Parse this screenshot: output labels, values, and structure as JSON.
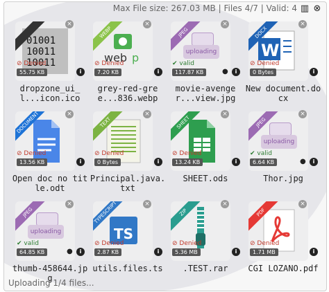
{
  "header": {
    "text": "Max File size: 267.03 MB | Files 4/7 | Valid: 4"
  },
  "footer": {
    "text": "Uploading 1/4 files..."
  },
  "labels": {
    "denied": "Denied",
    "valid": "valid",
    "uploading": "uploading",
    "remove_glyph": "×",
    "info_glyph": "i",
    "eye_glyph": "●"
  },
  "files": [
    {
      "name": "dropzone_ui_l...icon.ico",
      "type": "ico",
      "status": "Denied",
      "size": "55.75 KB",
      "ribbon": "",
      "ribbon_color": "#333333"
    },
    {
      "name": "grey-red-gree...836.webp",
      "type": "webp",
      "status": "Denied",
      "size": "7.20 KB",
      "ribbon": "WEBP",
      "ribbon_color": "#8bc34a"
    },
    {
      "name": "movie-avenger...view.jpg",
      "type": "jpeg",
      "status": "valid",
      "size": "117.87 KB",
      "ribbon": "JPEG",
      "ribbon_color": "#9c6bb3",
      "uploading": true
    },
    {
      "name": "New document.docx",
      "type": "docx",
      "status": "Denied",
      "size": "0 Bytes",
      "ribbon": "DOCX",
      "ribbon_color": "#1f63b5"
    },
    {
      "name": "Open doc no title.odt",
      "type": "document",
      "status": "Denied",
      "size": "13.56 KB",
      "ribbon": "DOCUMENT",
      "ribbon_color": "#1e73d6"
    },
    {
      "name": "Principal.java.txt",
      "type": "text",
      "status": "Denied",
      "size": "0 Bytes",
      "ribbon": "TEXT",
      "ribbon_color": "#7cb342"
    },
    {
      "name": "SHEET.ods",
      "type": "sheet",
      "status": "Denied",
      "size": "13.24 KB",
      "ribbon": "SHEET",
      "ribbon_color": "#2e9e4f"
    },
    {
      "name": "Thor.jpg",
      "type": "jpeg",
      "status": "valid",
      "size": "6.64 KB",
      "ribbon": "JPEG",
      "ribbon_color": "#9c6bb3",
      "uploading": true
    },
    {
      "name": "thumb-458644.jpg",
      "type": "jpeg",
      "status": "valid",
      "size": "64.85 KB",
      "ribbon": "JPEG",
      "ribbon_color": "#9c6bb3",
      "uploading": true
    },
    {
      "name": "utils.files.ts",
      "type": "typescript",
      "status": "Denied",
      "size": "2.87 KB",
      "ribbon": "TYPESCRIPT",
      "ribbon_color": "#3178c6"
    },
    {
      "name": ".TEST.rar",
      "type": "zip",
      "status": "Denied",
      "size": "5.36 MB",
      "ribbon": "ZIP",
      "ribbon_color": "#2a9d8f"
    },
    {
      "name": "CGI LOZANO.pdf",
      "type": "pdf",
      "status": "Denied",
      "size": "1.71 MB",
      "ribbon": "PDF",
      "ribbon_color": "#e53935"
    }
  ]
}
